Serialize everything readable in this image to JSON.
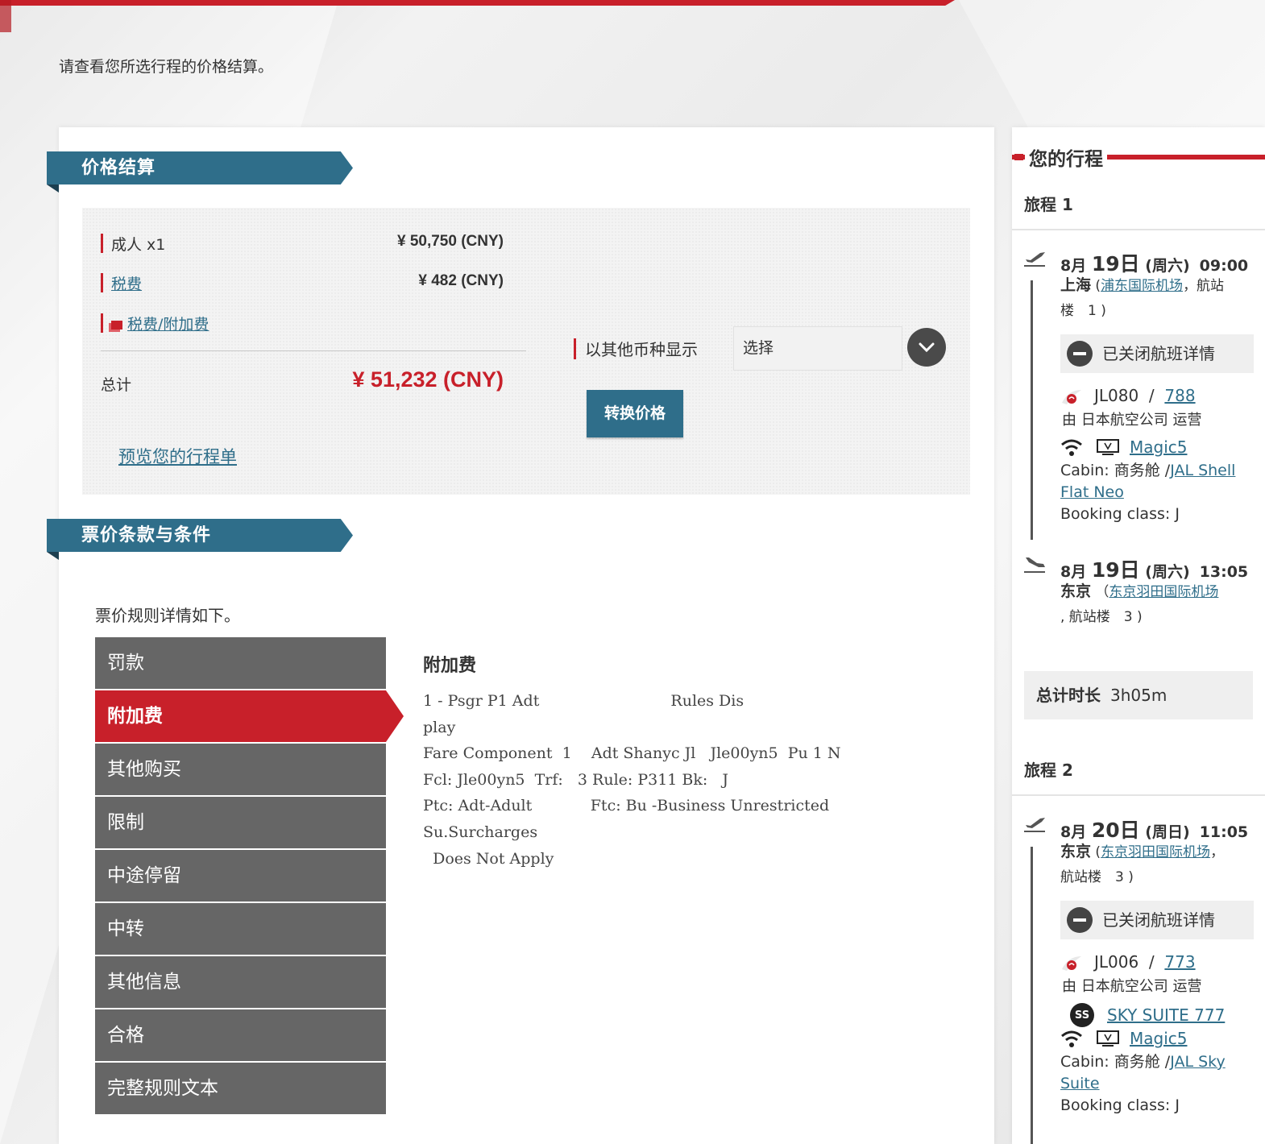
{
  "intro": "请查看您所选行程的价格结算。",
  "price_section": {
    "title": "价格结算",
    "rows": [
      {
        "label": "成人 x1",
        "value": "¥ 50,750 (CNY)"
      },
      {
        "label": "税费",
        "value": "¥ 482 (CNY)"
      },
      {
        "label": "税费/附加费",
        "value": ""
      }
    ],
    "total_label": "总计",
    "total_value": "¥ 51,232 (CNY)",
    "preview_link": "预览您的行程单",
    "currency_label": "以其他币种显示",
    "currency_select": "选择",
    "convert_button": "转换价格"
  },
  "fare_section": {
    "title": "票价条款与条件",
    "intro": "票价规则详情如下。",
    "menu": [
      "罚款",
      "附加费",
      "其他购买",
      "限制",
      "中途停留",
      "中转",
      "其他信息",
      "合格",
      "完整规则文本"
    ],
    "active_index": 1,
    "content_title": "附加费",
    "content_text": "1 - Psgr P1 Adt                           Rules Dis\nplay\nFare Component  1    Adt Shanyc Jl   Jle00yn5  Pu 1 N\nFcl: Jle00yn5  Trf:   3 Rule: P311 Bk:   J\nPtc: Adt-Adult            Ftc: Bu -Business Unrestricted\nSu.Surcharges\n  Does Not Apply"
  },
  "itinerary": {
    "title": "您的行程",
    "trips": [
      {
        "label": "旅程 1",
        "dep": {
          "month": "8月",
          "day": "19日",
          "weekday": "(周六)",
          "time": "09:00",
          "city": "上海",
          "airport": "浦东国际机场",
          "terminal_pre": "，航站",
          "terminal_post": "楼　1 )"
        },
        "closed_label": "已关闭航班详情",
        "flight_no": "JL080",
        "aircraft": "788",
        "operator": "由 日本航空公司 运营",
        "entertainment": "Magic5",
        "cabin_pre": "Cabin: 商务舱 /",
        "cabin_link": "JAL Shell Flat Neo",
        "booking_class": "Booking class: J",
        "arr": {
          "month": "8月",
          "day": "19日",
          "weekday": "(周六)",
          "time": "13:05",
          "city": "东京",
          "airport": "东京羽田国际机场",
          "terminal": ", 航站楼　3 )"
        },
        "duration_label": "总计时长",
        "duration": "3h05m"
      },
      {
        "label": "旅程 2",
        "dep": {
          "month": "8月",
          "day": "20日",
          "weekday": "(周日)",
          "time": "11:05",
          "city": "东京",
          "airport": "东京羽田国际机场",
          "terminal": "航站楼　3 )"
        },
        "closed_label": "已关闭航班详情",
        "flight_no": "JL006",
        "aircraft": "773",
        "operator": "由 日本航空公司 运营",
        "seat_product": "SKY SUITE 777",
        "entertainment": "Magic5",
        "cabin_pre": "Cabin: 商务舱 /",
        "cabin_link": "JAL Sky Suite",
        "booking_class": "Booking class: J"
      }
    ]
  },
  "colors": {
    "brand_red": "#c8202a",
    "brand_teal": "#2f6e8a",
    "menu_gray": "#666666"
  },
  "icons": [
    "chevron-down-icon",
    "fee-icon",
    "takeoff-icon",
    "landing-icon",
    "minus-circle-icon",
    "jal-logo-icon",
    "wifi-icon",
    "monitor-icon",
    "sky-suite-icon"
  ]
}
